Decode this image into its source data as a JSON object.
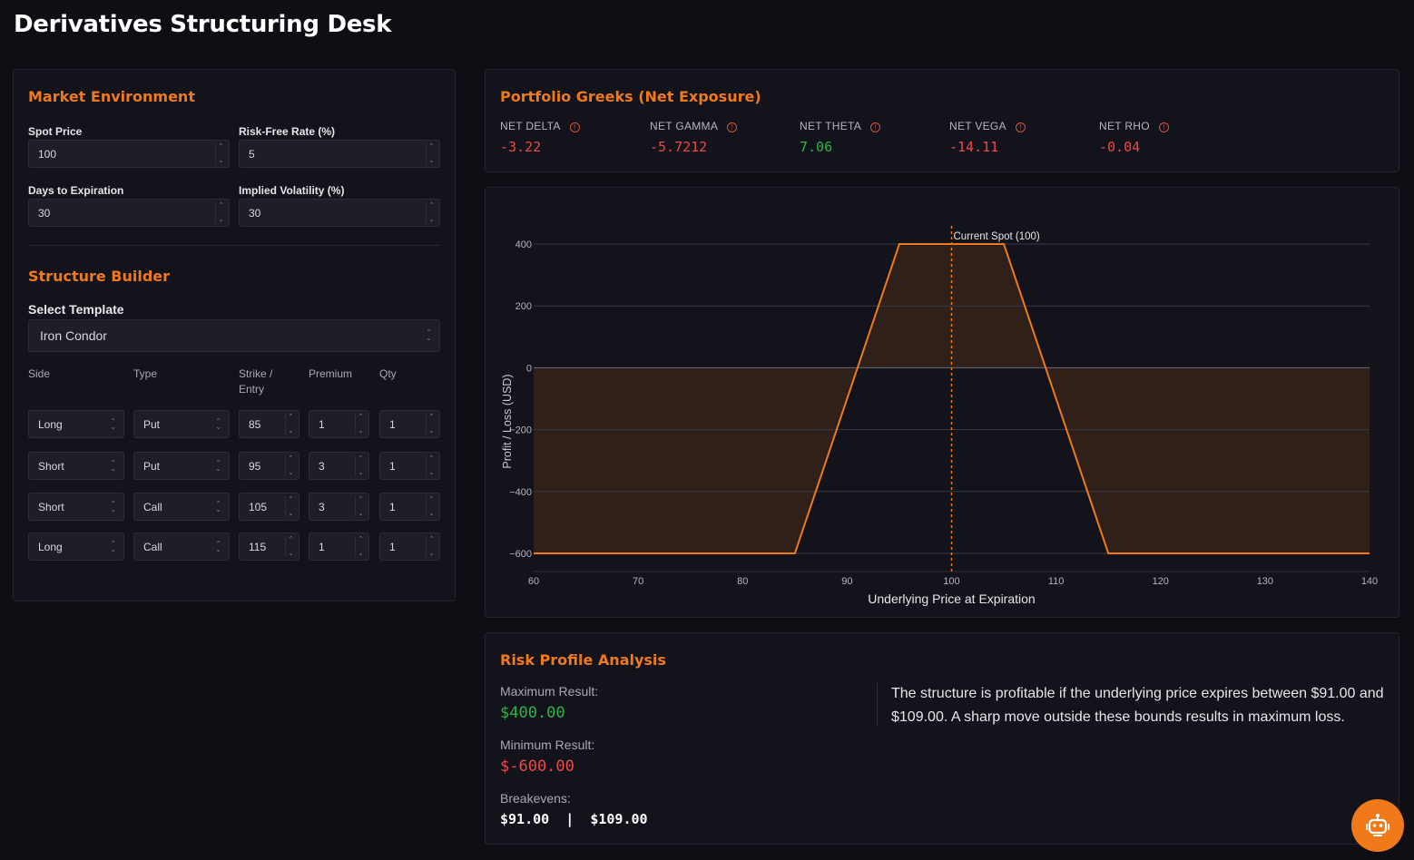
{
  "app_title": "Derivatives Structuring Desk",
  "market": {
    "title": "Market Environment",
    "spot_label": "Spot Price",
    "spot_value": "100",
    "rate_label": "Risk-Free Rate (%)",
    "rate_value": "5",
    "days_label": "Days to Expiration",
    "days_value": "30",
    "vol_label": "Implied Volatility (%)",
    "vol_value": "30"
  },
  "builder": {
    "title": "Structure Builder",
    "template_label": "Select Template",
    "template_value": "Iron Condor",
    "columns": {
      "side": "Side",
      "type": "Type",
      "strike_line1": "Strike /",
      "strike_line2": "Entry",
      "premium": "Premium",
      "qty": "Qty"
    },
    "legs": [
      {
        "side": "Long",
        "type": "Put",
        "strike": "85",
        "premium": "1",
        "qty": "1"
      },
      {
        "side": "Short",
        "type": "Put",
        "strike": "95",
        "premium": "3",
        "qty": "1"
      },
      {
        "side": "Short",
        "type": "Call",
        "strike": "105",
        "premium": "3",
        "qty": "1"
      },
      {
        "side": "Long",
        "type": "Call",
        "strike": "115",
        "premium": "1",
        "qty": "1"
      }
    ]
  },
  "greeks": {
    "title": "Portfolio Greeks (Net Exposure)",
    "items": [
      {
        "name": "NET DELTA",
        "value": "-3.22",
        "tone": "neg"
      },
      {
        "name": "NET GAMMA",
        "value": "-5.7212",
        "tone": "neg"
      },
      {
        "name": "NET THETA",
        "value": "7.06",
        "tone": "pos"
      },
      {
        "name": "NET VEGA",
        "value": "-14.11",
        "tone": "neg"
      },
      {
        "name": "NET RHO",
        "value": "-0.04",
        "tone": "neg"
      }
    ]
  },
  "chart_data": {
    "type": "line",
    "xlabel": "Underlying Price at Expiration",
    "ylabel": "Profit / Loss (USD)",
    "xlim": [
      60,
      140
    ],
    "ylim": [
      -600,
      400
    ],
    "x_ticks": [
      60,
      70,
      80,
      90,
      100,
      110,
      120,
      130,
      140
    ],
    "x_tick_labels": [
      "60",
      "70",
      "80",
      "90",
      "100",
      "110",
      "120",
      "130",
      "140"
    ],
    "y_ticks": [
      400,
      200,
      0,
      -200,
      -400,
      -600
    ],
    "y_tick_labels": [
      "400",
      "200",
      "0",
      "−200",
      "−400",
      "−600"
    ],
    "grid": true,
    "spot_annotation": "Current Spot (100)",
    "spot_x": 100,
    "series": [
      {
        "x": [
          60,
          85,
          95,
          105,
          115,
          140
        ],
        "y": [
          -600,
          -600,
          400,
          400,
          -600,
          -600
        ],
        "color": "#f07a1a"
      }
    ]
  },
  "risk": {
    "title": "Risk Profile Analysis",
    "max_label": "Maximum Result:",
    "max_value": "$400.00",
    "min_label": "Minimum Result:",
    "min_value": "$-600.00",
    "be_label": "Breakevens:",
    "be_value": "$91.00  |  $109.00",
    "summary": "The structure is profitable if the underlying price expires between $91.00 and $109.00. A sharp move outside these bounds results in maximum loss."
  },
  "colors": {
    "accent": "#f07a1a",
    "negative": "#f0474b",
    "positive": "#2eb34a",
    "background": "#0e0e14",
    "panel": "#13131b"
  }
}
